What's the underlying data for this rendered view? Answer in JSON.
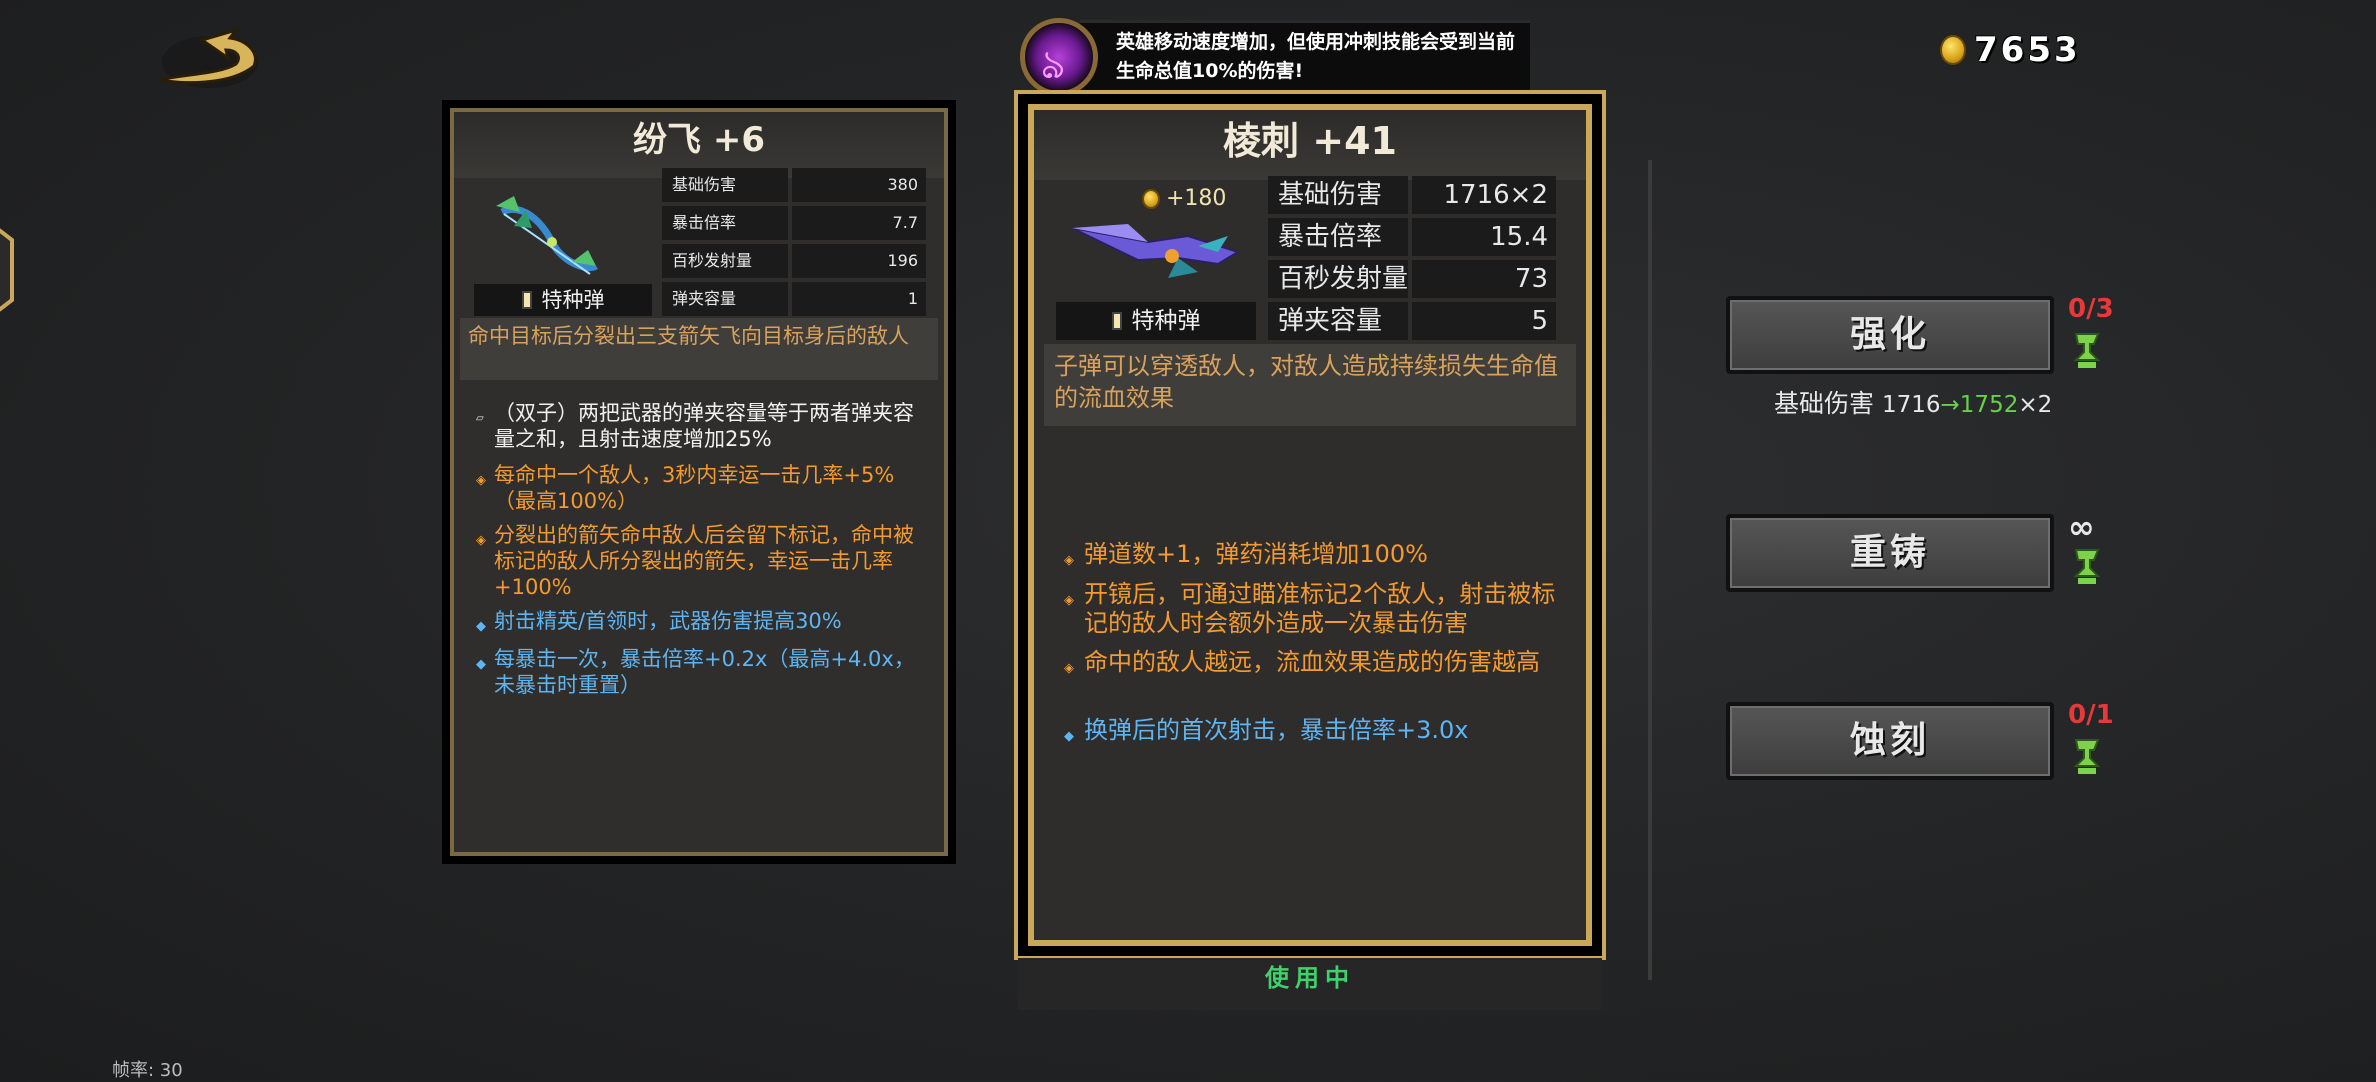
{
  "buff": {
    "icon": "purple-flame-orb-icon",
    "text": "英雄移动速度增加，但使用冲刺技能会受到当前生命总值10%的伤害!"
  },
  "currency": {
    "icon": "gold-coin-icon",
    "amount": "7653"
  },
  "left_weapon": {
    "title": "纷飞 +6",
    "stats": [
      {
        "label": "基础伤害",
        "value": "380"
      },
      {
        "label": "暴击倍率",
        "value": "7.7"
      },
      {
        "label": "百秒发射量",
        "value": "196"
      },
      {
        "label": "弹夹容量",
        "value": "1"
      }
    ],
    "ammo_type": "特种弹",
    "description": "命中目标后分裂出三支箭矢飞向目标身后的敌人",
    "traits": [
      {
        "color": "white",
        "text": "（双子）两把武器的弹夹容量等于两者弹夹容量之和，且射击速度增加25%"
      },
      {
        "color": "orange",
        "text": "每命中一个敌人，3秒内幸运一击几率+5%（最高100%）"
      },
      {
        "color": "orange",
        "text": "分裂出的箭矢命中敌人后会留下标记，命中被标记的敌人所分裂出的箭矢，幸运一击几率+100%"
      },
      {
        "color": "blue",
        "text": "射击精英/首领时，武器伤害提高30%"
      },
      {
        "color": "blue",
        "text": "每暴击一次，暴击倍率+0.2x（最高+4.0x，未暴击时重置）"
      }
    ]
  },
  "right_weapon": {
    "title": "棱刺 +41",
    "sell_price": "+180",
    "stats": [
      {
        "label": "基础伤害",
        "value": "1716×2"
      },
      {
        "label": "暴击倍率",
        "value": "15.4"
      },
      {
        "label": "百秒发射量",
        "value": "73"
      },
      {
        "label": "弹夹容量",
        "value": "5"
      }
    ],
    "ammo_type": "特种弹",
    "description": "子弹可以穿透敌人，对敌人造成持续损失生命值的流血效果",
    "traits": [
      {
        "color": "orange",
        "text": "弹道数+1，弹药消耗增加100%"
      },
      {
        "color": "orange",
        "text": "开镜后，可通过瞄准标记2个敌人，射击被标记的敌人时会额外造成一次暴击伤害"
      },
      {
        "color": "orange",
        "text": "命中的敌人越远，流血效果造成的伤害越高"
      },
      {
        "color": "blue",
        "text": "换弹后的首次射击，暴击倍率+3.0x"
      }
    ],
    "status": "使用中"
  },
  "actions": {
    "upgrade": {
      "label": "强化",
      "count": "0/3"
    },
    "upgrade_preview": {
      "stat": "基础伤害",
      "from": "1716",
      "arrow": "→",
      "to": "1752",
      "mult": "×2"
    },
    "reforge": {
      "label": "重铸",
      "count": "∞"
    },
    "etch": {
      "label": "蚀刻",
      "count": "0/1"
    }
  },
  "fps": "帧率: 30",
  "colors": {
    "gold_frame": "#c9a85a",
    "orange_text": "#f39a32",
    "blue_text": "#5fb4f2",
    "green_text": "#3fd16a",
    "red_count": "#e63a3a"
  }
}
